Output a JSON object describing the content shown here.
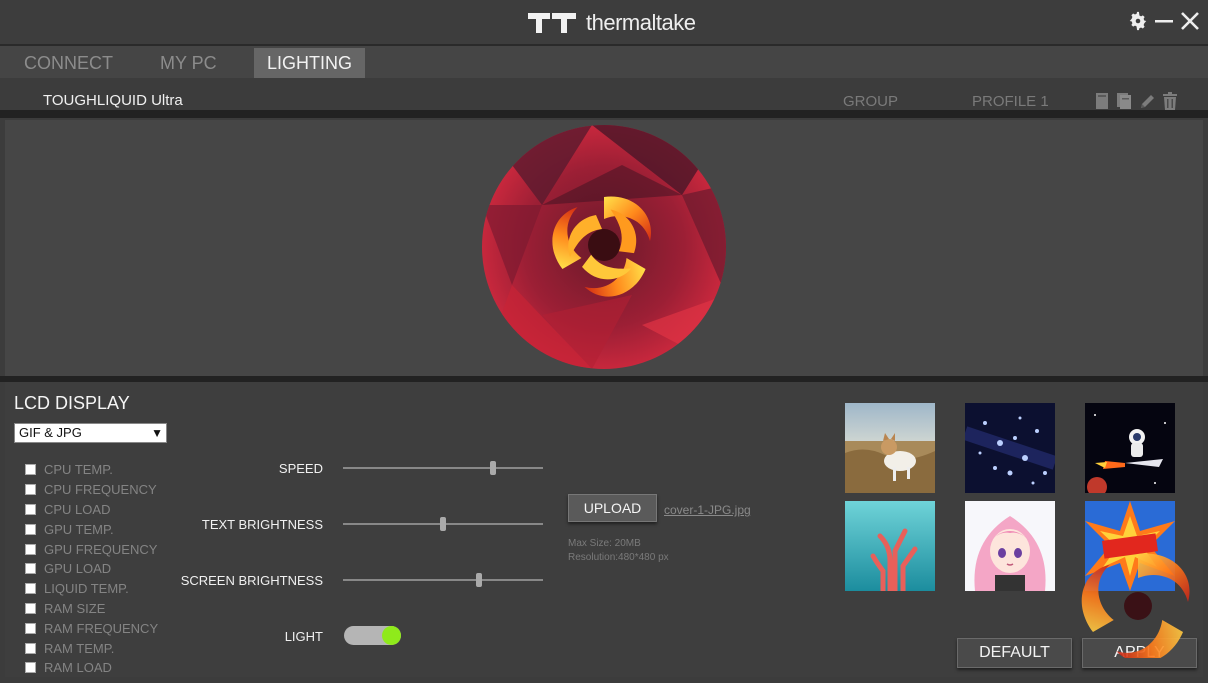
{
  "app": {
    "brand": "thermaltake"
  },
  "window_controls": {
    "settings": "settings-icon",
    "minimize": "minimize-icon",
    "close": "close-icon"
  },
  "tabs": [
    {
      "label": "CONNECT",
      "active": false
    },
    {
      "label": "MY PC",
      "active": false
    },
    {
      "label": "LIGHTING",
      "active": true
    }
  ],
  "subbar": {
    "device": "TOUGHLIQUID Ultra",
    "group": "GROUP",
    "profile": "PROFILE 1",
    "icons": [
      "new-profile-icon",
      "copy-profile-icon",
      "edit-icon",
      "trash-icon"
    ]
  },
  "lcd": {
    "title": "LCD DISPLAY",
    "mode": "GIF & JPG",
    "metrics": [
      "CPU TEMP.",
      "CPU FREQUENCY",
      "CPU LOAD",
      "GPU TEMP.",
      "GPU FREQUENCY",
      "GPU LOAD",
      "LIQUID TEMP.",
      "RAM SIZE",
      "RAM FREQUENCY",
      "RAM TEMP.",
      "RAM LOAD"
    ]
  },
  "controls": {
    "speed": {
      "label": "SPEED",
      "value": 0.75
    },
    "text_brightness": {
      "label": "TEXT BRIGHTNESS",
      "value": 0.5
    },
    "screen_brightness": {
      "label": "SCREEN BRIGHTNESS",
      "value": 0.68
    },
    "light": {
      "label": "LIGHT",
      "on": true
    }
  },
  "upload": {
    "button": "UPLOAD",
    "filename": "cover-1-JPG.jpg",
    "max_size": "Max Size: 20MB",
    "resolution": "Resolution:480*480 px"
  },
  "gallery": [
    "dog-photo",
    "space-particles",
    "astronaut-rocket",
    "coral-underwater",
    "anime-girl",
    "wow-comic"
  ],
  "actions": {
    "default": "DEFAULT",
    "apply": "APPLY"
  },
  "colors": {
    "accent_red": "#c01820",
    "toggle_on": "#8fea1b",
    "background": "#3c3c3c"
  }
}
